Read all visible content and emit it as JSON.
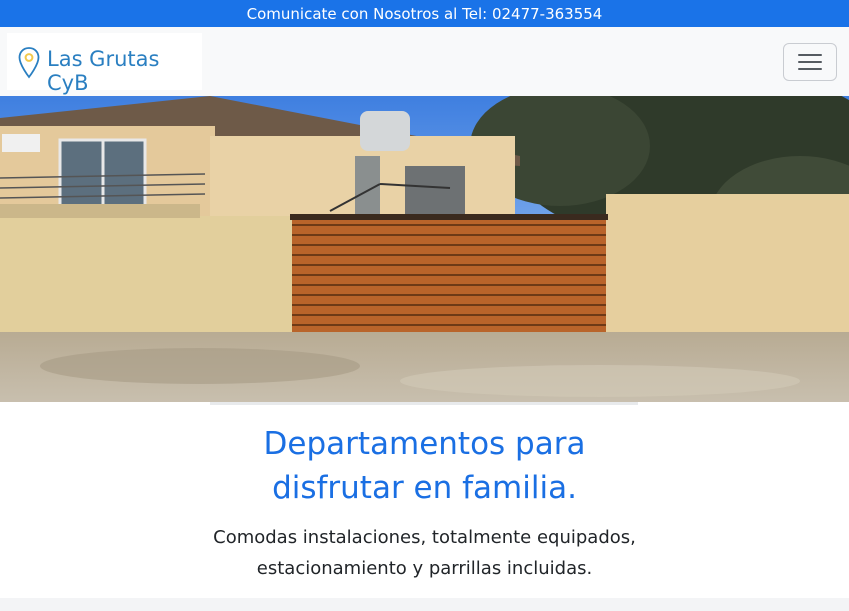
{
  "topbar": {
    "text": "Comunicate con Nosotros al Tel: 02477-363554"
  },
  "navbar": {
    "brand_name": "Las Grutas CyB",
    "brand_icon": "map-pin-icon",
    "toggler_icon": "hamburger-menu-icon"
  },
  "hero": {
    "image_description_icon": "house-photo"
  },
  "intro": {
    "heading_line1": "Departamentos para",
    "heading_line2": "disfrutar en familia.",
    "lead_line1": "Comodas instalaciones, totalmente equipados,",
    "lead_line2": "estacionamiento y parrillas incluidas."
  },
  "colors": {
    "topbar": "#1a73e8",
    "heading": "#1a6fe3",
    "brand_text": "#2a7fc1",
    "brand_pin": "#f2c94c"
  }
}
